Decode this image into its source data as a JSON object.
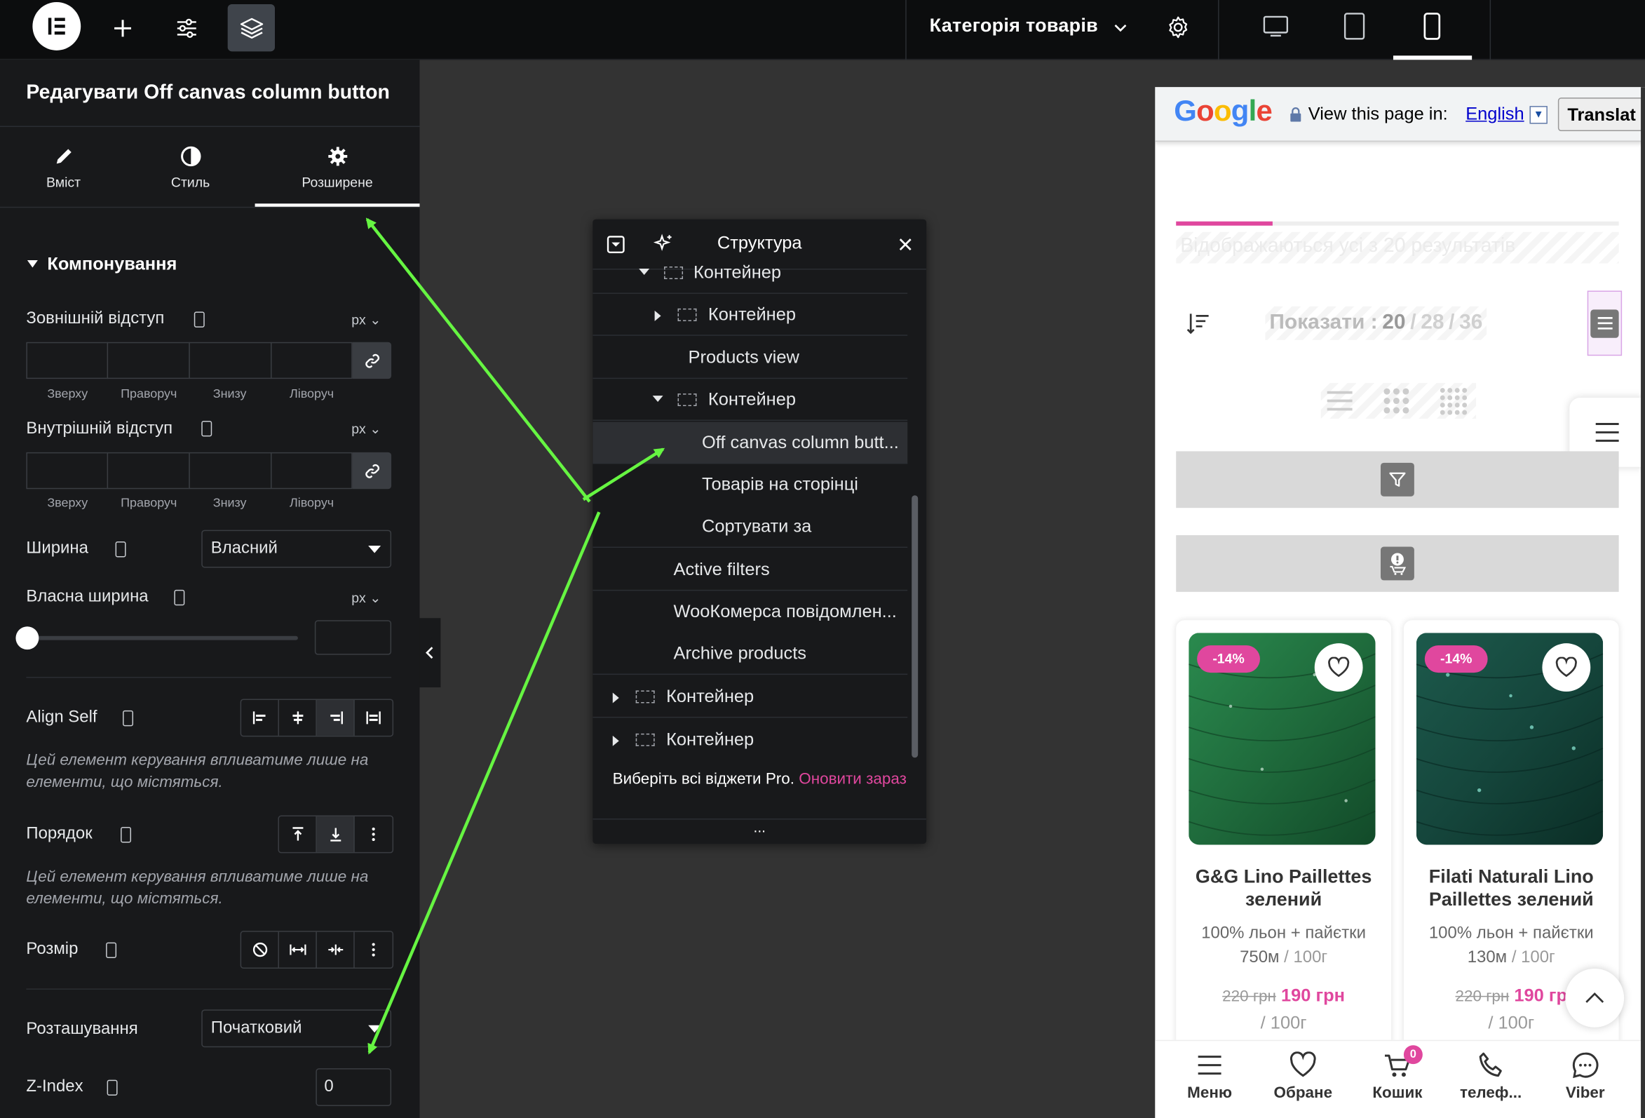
{
  "topbar": {
    "document_title": "Категорія товарів"
  },
  "panel": {
    "title": "Редагувати Off canvas column button",
    "tabs": [
      {
        "label": "Вміст"
      },
      {
        "label": "Стиль"
      },
      {
        "label": "Розширене"
      }
    ],
    "section_title": "Компонування",
    "margin": {
      "label": "Зовнішній відступ",
      "unit": "px",
      "sides": [
        "Зверху",
        "Праворуч",
        "Знизу",
        "Ліворуч"
      ]
    },
    "padding": {
      "label": "Внутрішній відступ",
      "unit": "px",
      "sides": [
        "Зверху",
        "Праворуч",
        "Знизу",
        "Ліворуч"
      ]
    },
    "width": {
      "label": "Ширина",
      "value": "Власний"
    },
    "custom_width": {
      "label": "Власна ширина",
      "unit": "px",
      "slider_level": 0
    },
    "align_self": {
      "label": "Align Self",
      "note": "Цей елемент керування впливатиме лише на елементи, що містяться."
    },
    "order": {
      "label": "Порядок",
      "note": "Цей елемент керування впливатиме лише на елементи, що містяться."
    },
    "size": {
      "label": "Розмір"
    },
    "position": {
      "label": "Розташування",
      "value": "Початковий"
    },
    "zindex": {
      "label": "Z-Index",
      "value": "0"
    }
  },
  "navigator": {
    "title": "Структура",
    "rows": [
      {
        "label": "Контейнер"
      },
      {
        "label": "Контейнер"
      },
      {
        "label": "Products view"
      },
      {
        "label": "Контейнер"
      },
      {
        "label": "Off canvas column butt..."
      },
      {
        "label": "Товарів на сторінці"
      },
      {
        "label": "Сортувати за"
      },
      {
        "label": "Active filters"
      },
      {
        "label": "WooКомерса повідомлен..."
      },
      {
        "label": "Archive products"
      },
      {
        "label": "Контейнер"
      },
      {
        "label": "Контейнер"
      }
    ],
    "promo_text": "Виберіть всі віджети Pro.",
    "promo_link": "Оновити зараз",
    "more": "..."
  },
  "preview": {
    "translate_bar": {
      "brand": "Google",
      "text": "View this page in:",
      "language": "English",
      "button": "Translat"
    },
    "results_text": "Відображаються усі з 20 результатів",
    "show": {
      "label": "Показати :",
      "options": [
        "20",
        "28",
        "36"
      ],
      "selected": "20"
    },
    "products": [
      {
        "badge": "-14%",
        "name": "G&G Lino Paillettes зелений",
        "desc": "100% льон + пайєтки 750м",
        "desc_unit": "/ 100г",
        "old_price": "220 грн",
        "new_price": "190 грн",
        "price_unit": "/ 100г",
        "img_color": "#1f6b3c"
      },
      {
        "badge": "-14%",
        "name": "Filati Naturali Lino Paillettes зелений",
        "desc": "100% льон + пайєтки 130м",
        "desc_unit": "/ 100г",
        "old_price": "220 грн",
        "new_price": "190 гр",
        "price_unit": "/ 100г",
        "img_color": "#15463c"
      }
    ],
    "bottom_nav": [
      {
        "label": "Меню",
        "icon": "menu-icon"
      },
      {
        "label": "Обране",
        "icon": "heart-icon"
      },
      {
        "label": "Кошик",
        "icon": "cart-icon",
        "badge": "0"
      },
      {
        "label": "телеф...",
        "icon": "phone-icon"
      },
      {
        "label": "Viber",
        "icon": "viber-icon"
      }
    ]
  },
  "colors": {
    "accent_pink": "#e0479e",
    "arrow_green": "#66f542"
  }
}
